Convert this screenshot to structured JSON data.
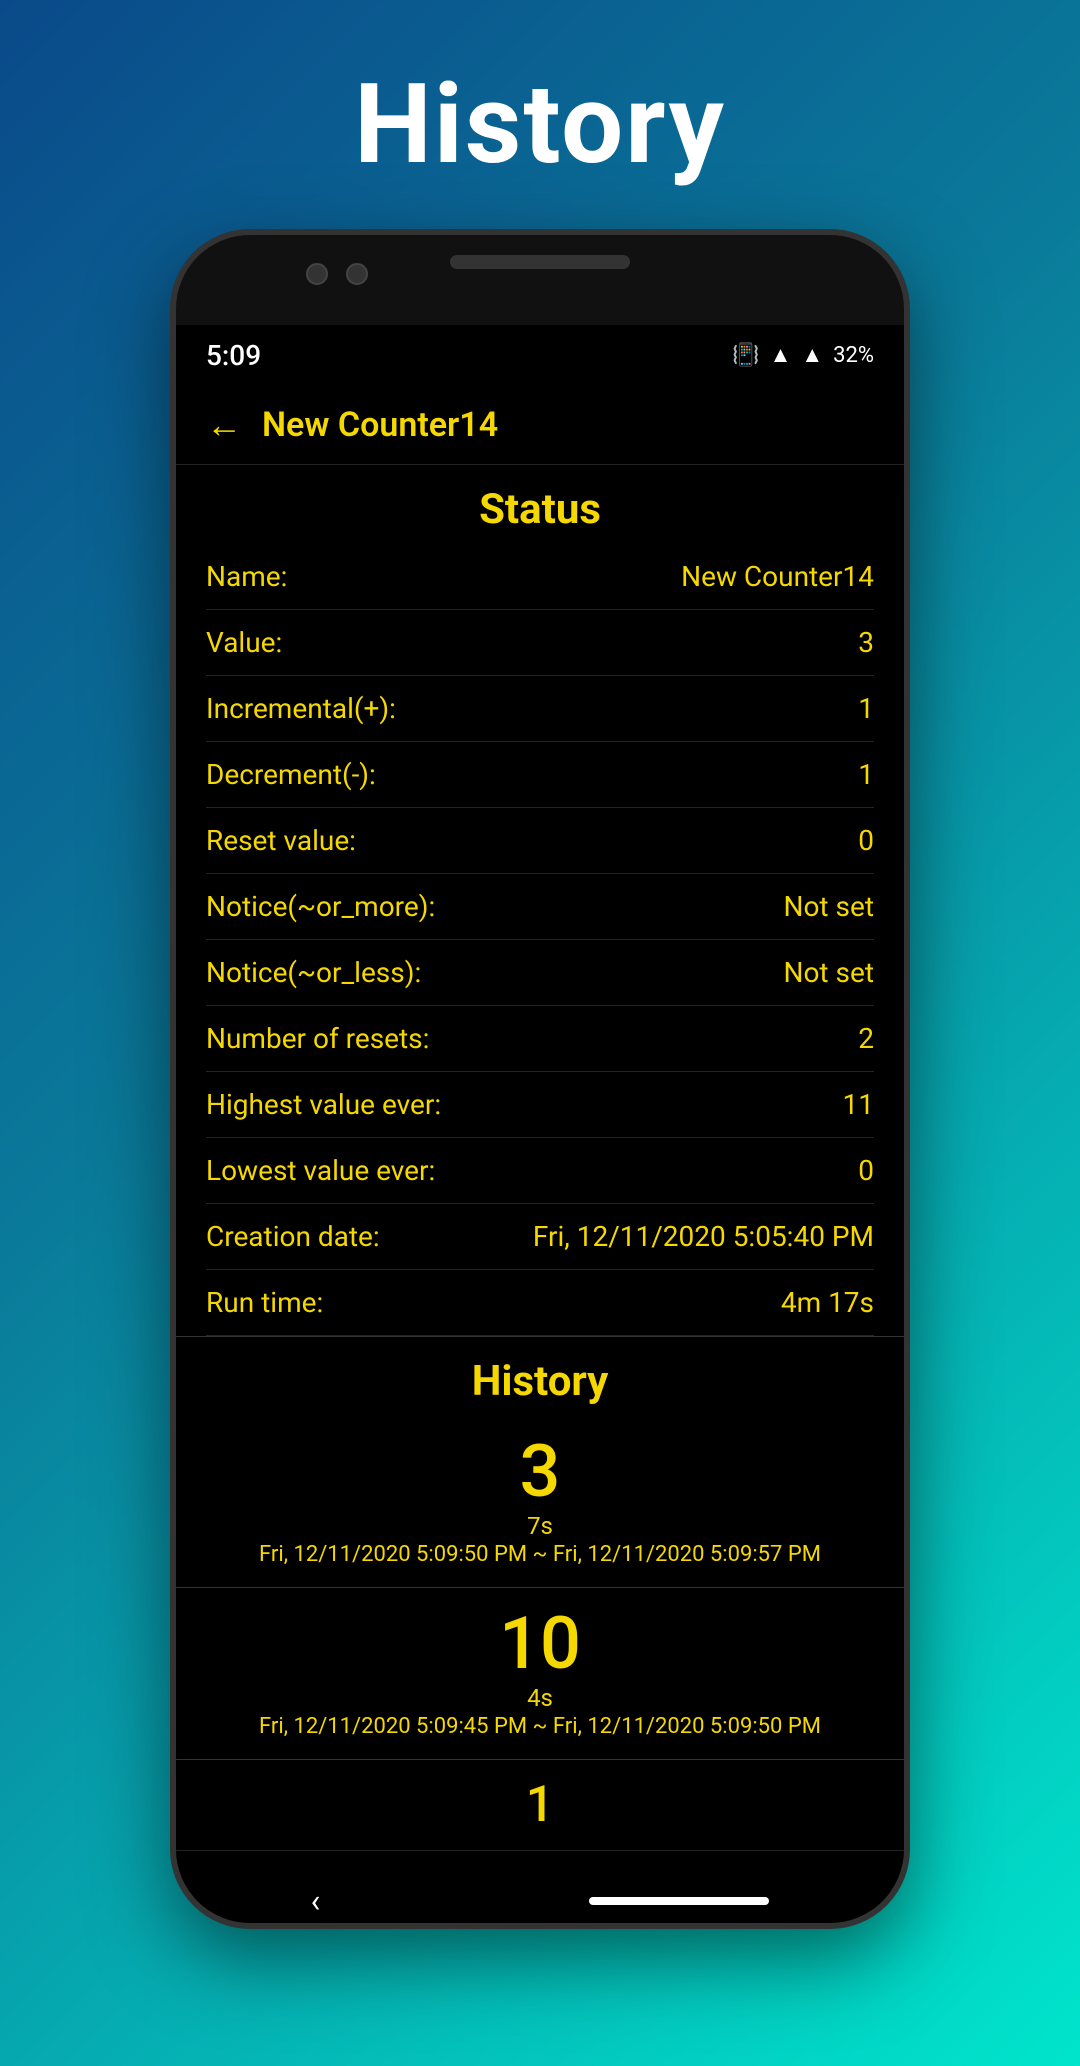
{
  "page": {
    "title": "History",
    "background_gradient_start": "#0a4a8a",
    "background_gradient_end": "#00e5cc"
  },
  "status_bar": {
    "time": "5:09",
    "battery": "32%"
  },
  "nav": {
    "back_label": "←",
    "counter_name": "New Counter14"
  },
  "status_section": {
    "title": "Status",
    "rows": [
      {
        "label": "Name:",
        "value": "New Counter14"
      },
      {
        "label": "Value:",
        "value": "3"
      },
      {
        "label": "Incremental(+):",
        "value": "1"
      },
      {
        "label": "Decrement(-):",
        "value": "1"
      },
      {
        "label": "Reset value:",
        "value": "0"
      },
      {
        "label": "Notice(~or_more):",
        "value": "Not set"
      },
      {
        "label": "Notice(~or_less):",
        "value": "Not set"
      },
      {
        "label": "Number of resets:",
        "value": "2"
      },
      {
        "label": "Highest value ever:",
        "value": "11"
      },
      {
        "label": "Lowest value ever:",
        "value": "0"
      },
      {
        "label": "Creation date:",
        "value": "Fri, 12/11/2020 5:05:40 PM"
      },
      {
        "label": "Run time:",
        "value": "4m 17s"
      }
    ]
  },
  "history_section": {
    "title": "History",
    "entries": [
      {
        "value": "3",
        "duration": "7s",
        "time_range": "Fri, 12/11/2020 5:09:50 PM ~ Fri, 12/11/2020 5:09:57 PM"
      },
      {
        "value": "10",
        "duration": "4s",
        "time_range": "Fri, 12/11/2020 5:09:45 PM ~ Fri, 12/11/2020 5:09:50 PM"
      },
      {
        "value": "1",
        "duration": "",
        "time_range": ""
      }
    ]
  },
  "bottom_nav": {
    "back_symbol": "‹"
  }
}
